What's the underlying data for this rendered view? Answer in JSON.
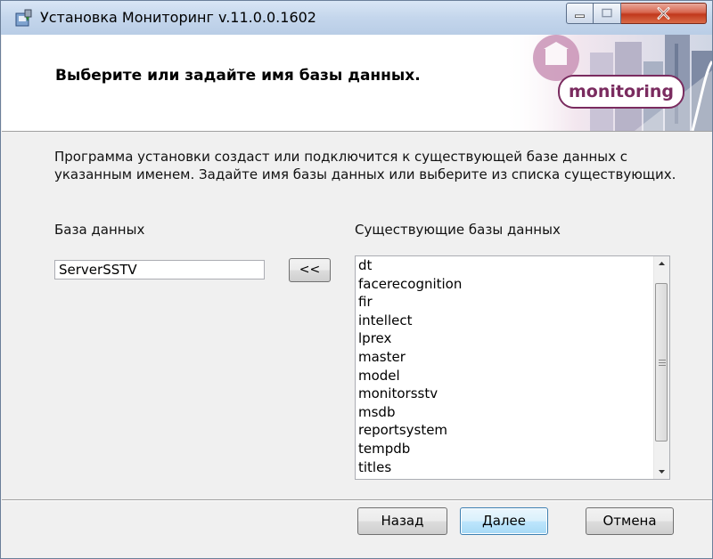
{
  "window": {
    "title": "Установка Мониторинг v.11.0.0.1602"
  },
  "banner": {
    "heading": "Выберите или задайте имя базы данных.",
    "logo_text": "monitoring"
  },
  "main": {
    "description_line1": "Программа установки создаст или подключится к существующей базе данных с",
    "description_line2": "указанным именем. Задайте имя базы данных или выберите из списка существующих.",
    "database_label": "База данных",
    "database_value": "ServerSSTV",
    "copy_button_label": "<<",
    "existing_label": "Существующие базы данных",
    "existing_databases": [
      "dt",
      "facerecognition",
      "fir",
      "intellect",
      "lprex",
      "master",
      "model",
      "monitorsstv",
      "msdb",
      "reportsystem",
      "tempdb",
      "titles"
    ]
  },
  "footer": {
    "back_label": "Назад",
    "next_label": "Далее",
    "cancel_label": "Отмена"
  },
  "colors": {
    "title_bar": "#c4d6ec",
    "close_button": "#c1381c",
    "logo_accent": "#7a2b5f",
    "default_button_border": "#3c7fb1"
  }
}
